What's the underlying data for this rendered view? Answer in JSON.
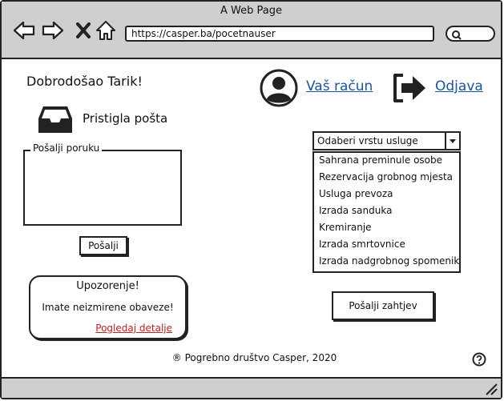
{
  "window": {
    "title": "A Web Page"
  },
  "browser": {
    "url": "https://casper.ba/pocetnauser",
    "back_icon": "arrow-left-icon",
    "forward_icon": "arrow-right-icon",
    "stop_icon": "close-icon",
    "home_icon": "home-icon",
    "search_icon": "search-icon"
  },
  "header": {
    "welcome": "Dobrodošao Tarik!",
    "account_link": "Vaš račun",
    "logout_link": "Odjava",
    "link_color": "#1a55a3"
  },
  "inbox": {
    "label": "Pristigla pošta",
    "icon": "inbox-icon"
  },
  "message": {
    "legend": "Pošalji poruku",
    "value": "",
    "send_label": "Pošalji"
  },
  "alert": {
    "title": "Upozorenje!",
    "text": "Imate neizmirene obaveze!",
    "link": "Pogledaj detalje",
    "link_color": "#c02020"
  },
  "service": {
    "placeholder": "Odaberi vrstu usluge",
    "options": [
      "Sahrana preminule osobe",
      "Rezervacija grobnog mjesta",
      "Usluga prevoza",
      "Izrada sanduka",
      "Kremiranje",
      "Izrada smrtovnice",
      "Izrada nadgrobnog spomenik"
    ],
    "submit_label": "Pošalji zahtjev"
  },
  "footer": {
    "text": "® Pogrebno društvo Casper, 2020",
    "help_icon": "help-icon"
  }
}
